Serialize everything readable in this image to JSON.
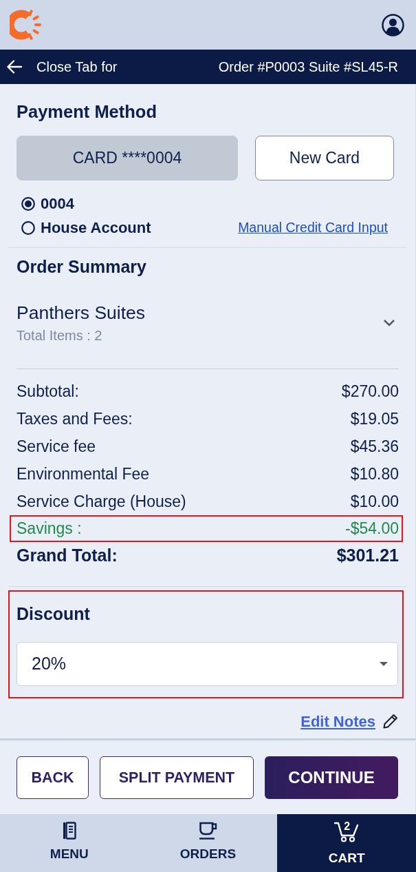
{
  "nav_bar": {
    "title": "Close Tab for",
    "order": "Order #P0003 Suite #SL45-R"
  },
  "payment_method": {
    "title": "Payment Method",
    "cards": [
      {
        "label": "CARD ****0004",
        "selected": true
      },
      {
        "label": "New Card",
        "selected": false
      }
    ],
    "options": [
      {
        "label": "0004",
        "selected": true
      },
      {
        "label": "House Account",
        "selected": false
      }
    ],
    "link": "Manual Credit Card Input"
  },
  "order_summary": {
    "title": "Order Summary",
    "group": {
      "name": "Panthers Suites",
      "subtitle": "Total Items : 2",
      "expanded": false
    },
    "lines": [
      {
        "label": "Subtotal:",
        "value": "$270.00",
        "kind": "normal",
        "highlighted": false
      },
      {
        "label": "Taxes and Fees:",
        "value": "$19.05",
        "kind": "normal",
        "highlighted": false
      },
      {
        "label": "Service fee",
        "value": "$45.36",
        "kind": "normal",
        "highlighted": false
      },
      {
        "label": "Environmental Fee",
        "value": "$10.80",
        "kind": "normal",
        "highlighted": false
      },
      {
        "label": "Service Charge (House)",
        "value": "$10.00",
        "kind": "normal",
        "highlighted": false
      },
      {
        "label": "Savings :",
        "value": "-$54.00",
        "kind": "savings",
        "highlighted": true
      },
      {
        "label": "Grand Total:",
        "value": "$301.21",
        "kind": "total",
        "highlighted": false
      }
    ]
  },
  "discount": {
    "title": "Discount",
    "value": "20%",
    "highlighted": true
  },
  "edit_notes": "Edit Notes",
  "actions": [
    {
      "label": "BACK",
      "kind": "outline"
    },
    {
      "label": "SPLIT PAYMENT",
      "kind": "outline"
    },
    {
      "label": "CONTINUE",
      "kind": "primary"
    }
  ],
  "bottom_nav": [
    {
      "label": "MENU",
      "selected": false
    },
    {
      "label": "ORDERS",
      "selected": false
    },
    {
      "label": "CART",
      "selected": true,
      "badge": "2"
    }
  ]
}
